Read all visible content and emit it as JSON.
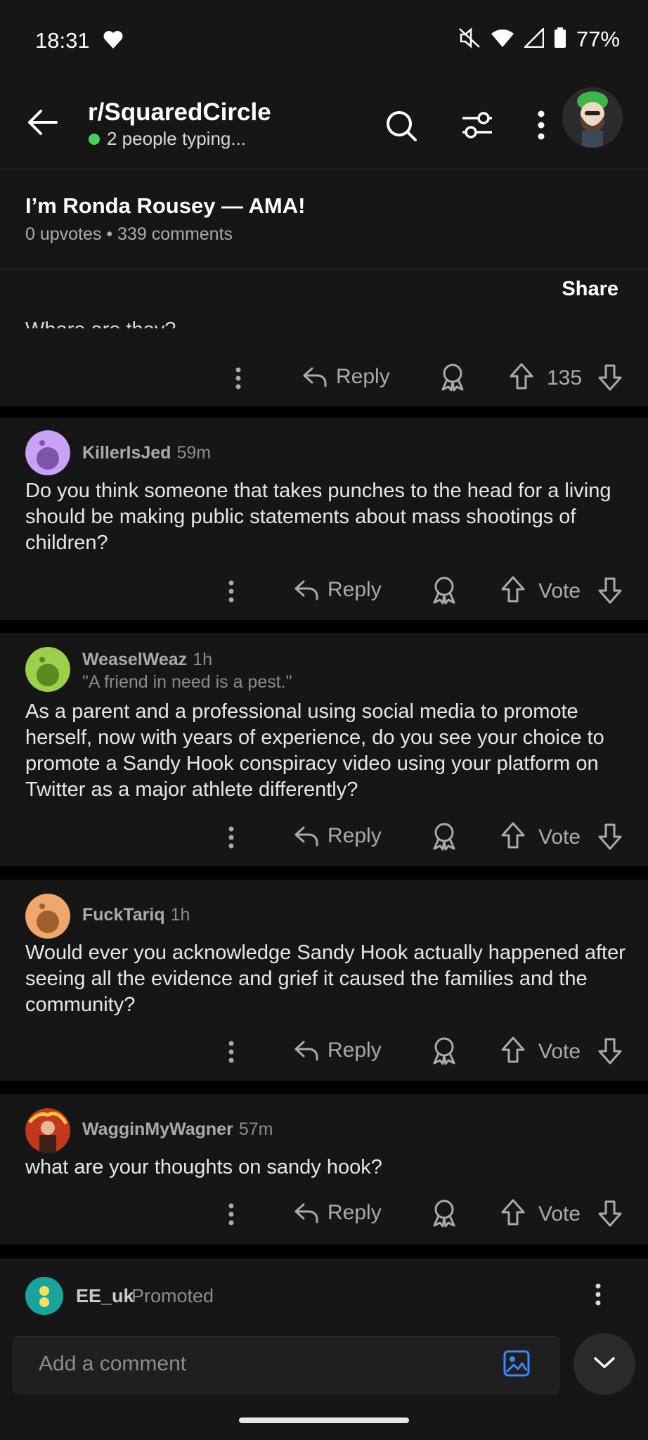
{
  "status": {
    "time": "18:31",
    "battery": "77%"
  },
  "header": {
    "subreddit": "r/SquaredCircle",
    "typing": "2 people typing..."
  },
  "post": {
    "title": "I’m Ronda Rousey — AMA!",
    "meta": "0 upvotes • 339 comments",
    "share_label": "Share"
  },
  "first_comment": {
    "cut_text": "Where are they?",
    "score": "135"
  },
  "actions": {
    "reply_label": "Reply",
    "vote_label": "Vote"
  },
  "comments": [
    {
      "user": "KillerIsJed",
      "time": "59m",
      "flair": "",
      "avatar_color": "#c9a1f5",
      "body": "Do you think someone that takes punches to the head for a living should be making public statements about mass shootings of children?"
    },
    {
      "user": "WeaselWeaz",
      "time": "1h",
      "flair": "\"A friend in need is a pest.\"",
      "avatar_color": "#9ad04b",
      "body": "As a parent and a professional using social media to promote herself, now with years of experience, do you see your choice to promote a Sandy Hook conspiracy video using your platform on Twitter as a major athlete differently?"
    },
    {
      "user": "FuckTariq",
      "time": "1h",
      "flair": "",
      "avatar_color": "#f0a76e",
      "body": "Would ever you acknowledge Sandy Hook actually happened after seeing all the evidence and grief it caused the families and the community?"
    },
    {
      "user": "WagginMyWagner",
      "time": "57m",
      "flair": "",
      "avatar_color": "#c0391e",
      "body": "what are your thoughts on sandy hook?"
    }
  ],
  "promo": {
    "user": "EE_uk",
    "label": "Promoted"
  },
  "composer": {
    "placeholder": "Add a comment"
  },
  "colors": {
    "accent_blue": "#3d88f5",
    "online_green": "#46d160"
  },
  "icons": [
    "back-arrow-icon",
    "search-icon",
    "filter-icon",
    "more-vertical-icon",
    "reply-icon",
    "award-icon",
    "upvote-icon",
    "downvote-icon",
    "image-icon",
    "chevron-down-icon"
  ]
}
